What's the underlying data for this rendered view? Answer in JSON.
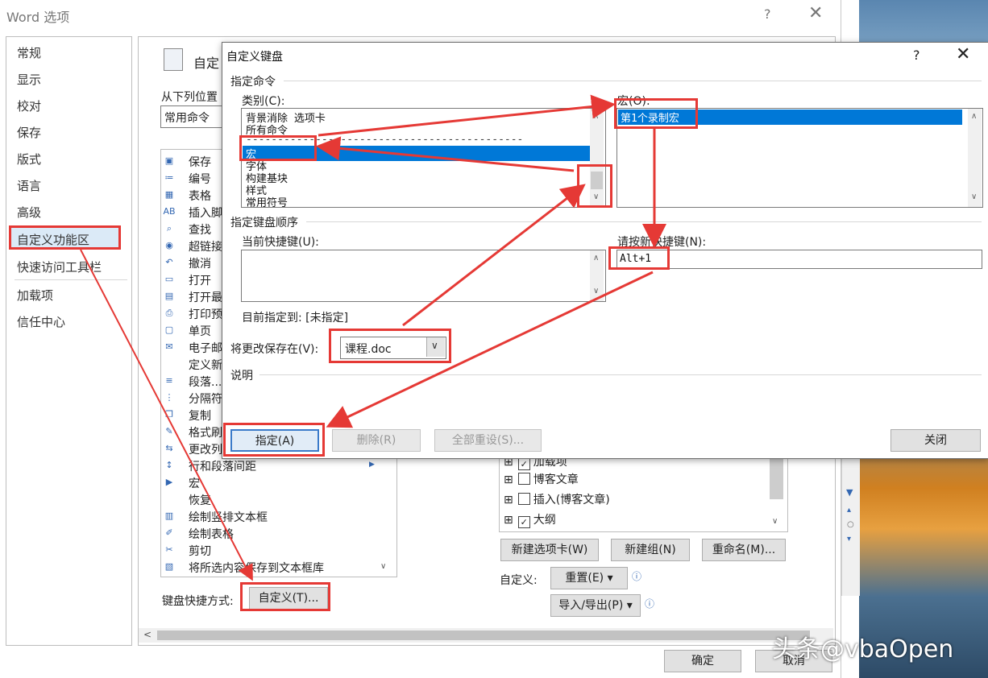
{
  "window": {
    "title": "Word 选项",
    "help": "?",
    "close": "✕"
  },
  "sidebar": {
    "items": [
      "常规",
      "显示",
      "校对",
      "保存",
      "版式",
      "语言",
      "高级",
      "自定义功能区",
      "快速访问工具栏",
      "加载项",
      "信任中心"
    ],
    "selected": "自定义功能区"
  },
  "panel": {
    "heading": "自定",
    "from_label": "从下列位置",
    "from_value": "常用命令",
    "commands": [
      {
        "icon": "save-icon",
        "glyph": "▣",
        "label": "保存"
      },
      {
        "icon": "numbering-icon",
        "glyph": "≔",
        "label": "编号"
      },
      {
        "icon": "table-icon",
        "glyph": "▦",
        "label": "表格"
      },
      {
        "icon": "footnote-icon",
        "glyph": "AB",
        "label": "插入脚"
      },
      {
        "icon": "find-icon",
        "glyph": "⌕",
        "label": "查找"
      },
      {
        "icon": "hyperlink-icon",
        "glyph": "◉",
        "label": "超链接"
      },
      {
        "icon": "undo-icon",
        "glyph": "↶",
        "label": "撤消"
      },
      {
        "icon": "open-icon",
        "glyph": "▭",
        "label": "打开"
      },
      {
        "icon": "recent-icon",
        "glyph": "▤",
        "label": "打开最"
      },
      {
        "icon": "print-preview-icon",
        "glyph": "⎙",
        "label": "打印预"
      },
      {
        "icon": "single-page-icon",
        "glyph": "▢",
        "label": "单页"
      },
      {
        "icon": "email-icon",
        "glyph": "✉",
        "label": "电子邮"
      },
      {
        "icon": "",
        "glyph": "",
        "label": "定义新"
      },
      {
        "icon": "paragraph-icon",
        "glyph": "≡",
        "label": "段落..."
      },
      {
        "icon": "separator-icon",
        "glyph": "⋮",
        "label": "分隔符"
      },
      {
        "icon": "copy-icon",
        "glyph": "❐",
        "label": "复制"
      },
      {
        "icon": "format-painter-icon",
        "glyph": "✎",
        "label": "格式刷"
      },
      {
        "icon": "track-changes-icon",
        "glyph": "⇆",
        "label": "更改列"
      },
      {
        "icon": "line-spacing-icon",
        "glyph": "↕",
        "label": "行和段落间距"
      },
      {
        "icon": "macro-icon",
        "glyph": "▶",
        "label": "宏"
      },
      {
        "icon": "",
        "glyph": "",
        "label": "恢复"
      },
      {
        "icon": "textbox-icon",
        "glyph": "▥",
        "label": "绘制竖排文本框"
      },
      {
        "icon": "draw-table-icon",
        "glyph": "✐",
        "label": "绘制表格"
      },
      {
        "icon": "cut-icon",
        "glyph": "✂",
        "label": "剪切"
      },
      {
        "icon": "save-selection-icon",
        "glyph": "▧",
        "label": "将所选内容保存到文本框库"
      }
    ],
    "keyboard_label": "键盘快捷方式:",
    "customize_button": "自定义(T)...",
    "tree": [
      {
        "label": "加载项",
        "checked": true
      },
      {
        "label": "博客文章",
        "checked": false
      },
      {
        "label": "插入(博客文章)",
        "checked": false
      },
      {
        "label": "大纲",
        "checked": true
      }
    ],
    "new_tab": "新建选项卡(W)",
    "new_group": "新建组(N)",
    "rename": "重命名(M)...",
    "custom_label": "自定义:",
    "reset": "重置(E) ▾",
    "import_export": "导入/导出(P) ▾",
    "ok": "确定",
    "cancel": "取消"
  },
  "dialog": {
    "title": "自定义键盘",
    "help": "?",
    "close": "✕",
    "assign_commands": "指定命令",
    "category_label": "类别(C):",
    "categories": [
      "背景消除 选项卡",
      "所有命令",
      "--------------------------------------------",
      "宏",
      "字体",
      "构建基块",
      "样式",
      "常用符号"
    ],
    "selected_category": "宏",
    "macros_label": "宏(O):",
    "macros": [
      "第1个录制宏"
    ],
    "keyboard_sequence": "指定键盘顺序",
    "current_keys_label": "当前快捷键(U):",
    "new_key_label": "请按新快捷键(N):",
    "new_key_value": "Alt+1",
    "currently_assigned": "目前指定到: [未指定]",
    "save_in_label": "将更改保存在(V):",
    "save_in_value": "课程.doc",
    "description_label": "说明",
    "assign_button": "指定(A)",
    "remove_button": "删除(R)",
    "reset_all_button": "全部重设(S)...",
    "close_button": "关闭"
  },
  "watermark": "头条@vbaOpen",
  "colors": {
    "accent": "#0078d7",
    "annotation": "#e53935",
    "selection_bg": "#dbeaf7"
  }
}
